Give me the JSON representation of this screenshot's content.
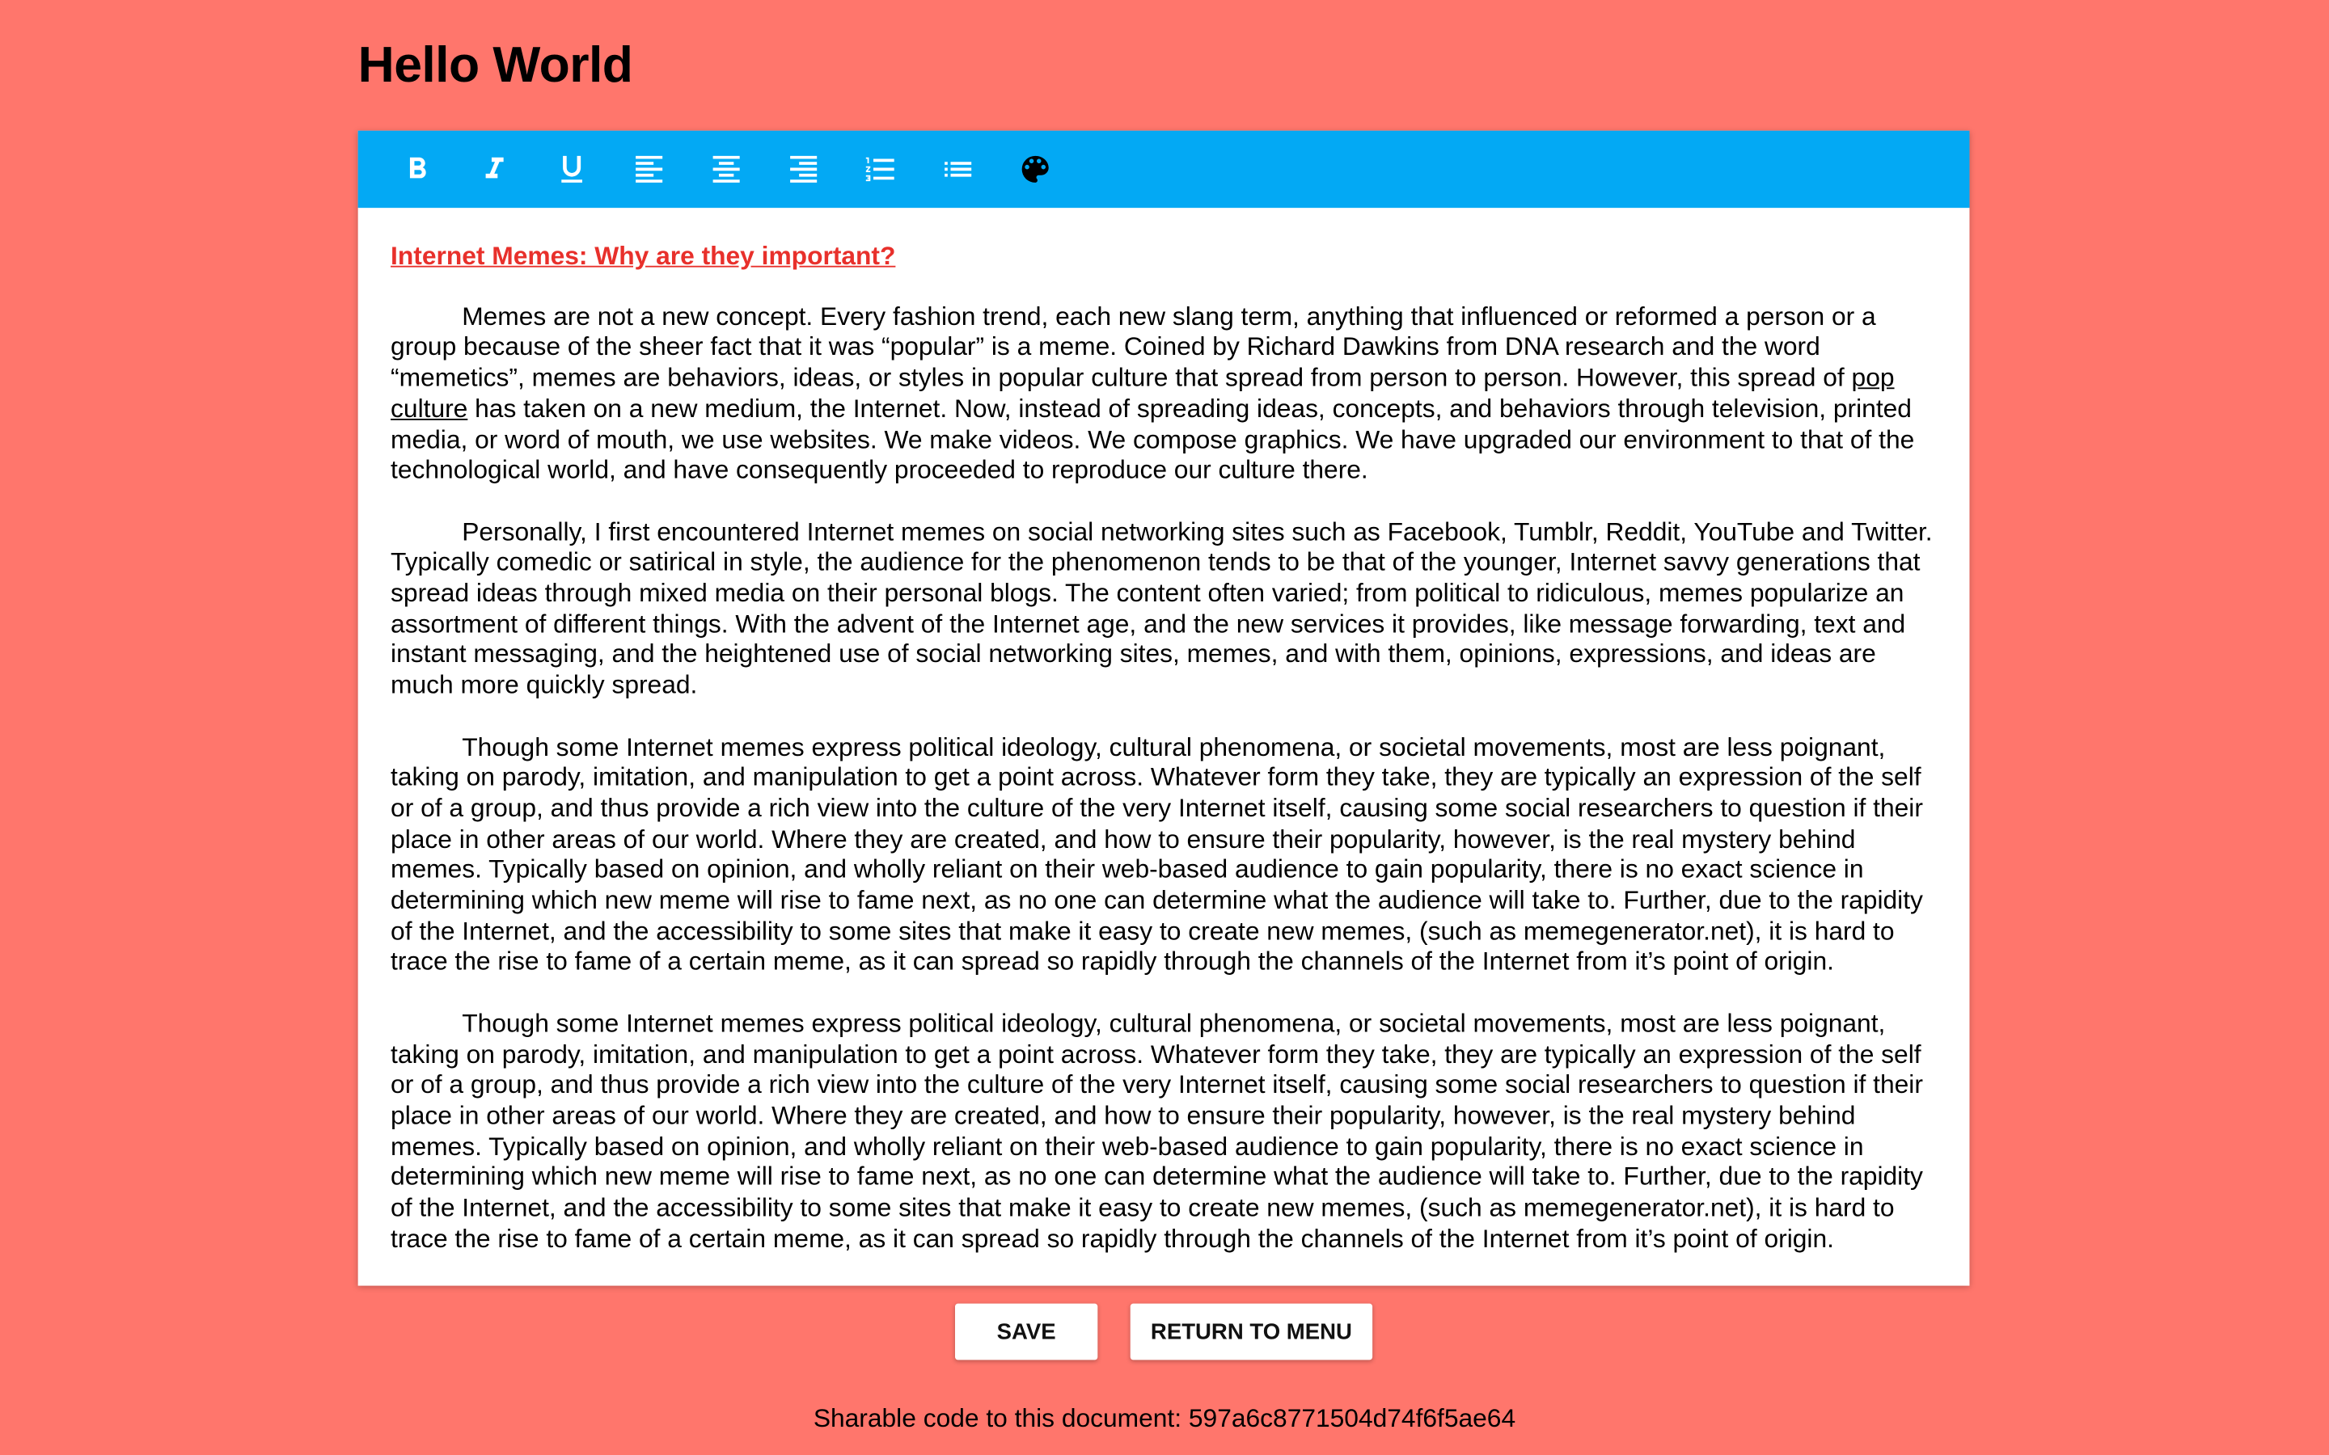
{
  "page": {
    "title": "Hello World"
  },
  "toolbar": {
    "color": "#03a9f4",
    "items": [
      {
        "name": "bold",
        "icon": "format-bold-icon"
      },
      {
        "name": "italic",
        "icon": "format-italic-icon"
      },
      {
        "name": "underline",
        "icon": "format-underline-icon"
      },
      {
        "name": "align-left",
        "icon": "align-left-icon"
      },
      {
        "name": "align-center",
        "icon": "align-center-icon"
      },
      {
        "name": "align-right",
        "icon": "align-right-icon"
      },
      {
        "name": "ordered-list",
        "icon": "ordered-list-icon"
      },
      {
        "name": "bulleted-list",
        "icon": "bulleted-list-icon"
      },
      {
        "name": "color",
        "icon": "palette-icon"
      }
    ]
  },
  "document": {
    "heading": "Internet Memes: Why are they important?",
    "heading_color": "#e8302b",
    "para1": {
      "before": "Memes are not a new concept. Every fashion trend, each new slang term, anything that influenced or reformed a person or a group because of the sheer fact that it was “popular” is a meme. Coined by Richard Dawkins from DNA research and the word “memetics”, memes are behaviors, ideas, or styles in popular culture that spread from person to person. However, this spread of ",
      "underlined": "pop culture",
      "after": " has taken on a new medium, the Internet. Now, instead of spreading ideas, concepts, and behaviors through television, printed media, or word of mouth, we use websites. We make videos. We compose graphics. We have upgraded our environment to that of the technological world, and have consequently proceeded to reproduce our culture there."
    },
    "para2": "Personally, I first encountered Internet memes on social networking sites such as Facebook, Tumblr, Reddit, YouTube and Twitter. Typically comedic or satirical in style, the audience for the phenomenon tends to be that of the younger, Internet savvy generations that spread ideas through mixed media on their personal blogs. The content often varied; from political to ridiculous, memes popularize an assortment of different things. With the advent of the Internet age, and the new services it provides, like message forwarding, text and instant messaging, and the heightened use of social networking sites, memes, and with them, opinions, expressions, and ideas are much more quickly spread.",
    "para3": "Though some Internet memes express political ideology, cultural phenomena, or societal movements, most are less poignant, taking on parody, imitation, and manipulation to get a point across. Whatever form they take, they are typically an expression of the self or of a group, and thus provide a rich view into the culture of the very Internet itself, causing some social researchers to question if their place in other areas of our world. Where they are created, and how to ensure their popularity, however, is the real mystery behind memes. Typically based on opinion, and wholly reliant on their web-based audience to gain popularity, there is no exact science in determining which new meme will rise to fame next, as no one can determine what the audience will take to. Further, due to the rapidity of the Internet, and the accessibility to some sites that make it easy to create new memes, (such as memegenerator.net), it is hard to trace the rise to fame of a certain meme, as it can spread so rapidly through the channels of the Internet from it’s point of origin.",
    "para4": "Though some Internet memes express political ideology, cultural phenomena, or societal movements, most are less poignant, taking on parody, imitation, and manipulation to get a point across. Whatever form they take, they are typically an expression of the self or of a group, and thus provide a rich view into the culture of the very Internet itself, causing some social researchers to question if their place in other areas of our world. Where they are created, and how to ensure their popularity, however, is the real mystery behind memes. Typically based on opinion, and wholly reliant on their web-based audience to gain popularity, there is no exact science in determining which new meme will rise to fame next, as no one can determine what the audience will take to. Further, due to the rapidity of the Internet, and the accessibility to some sites that make it easy to create new memes, (such as memegenerator.net), it is hard to trace the rise to fame of a certain meme, as it can spread so rapidly through the channels of the Internet from it’s point of origin."
  },
  "actions": {
    "save_label": "SAVE",
    "return_label": "RETURN TO MENU"
  },
  "share": {
    "label": "Sharable code to this document:",
    "code": "597a6c8771504d74f6f5ae64"
  },
  "colors": {
    "background": "#ff766c",
    "toolbar": "#03a9f4",
    "heading": "#e8302b"
  }
}
